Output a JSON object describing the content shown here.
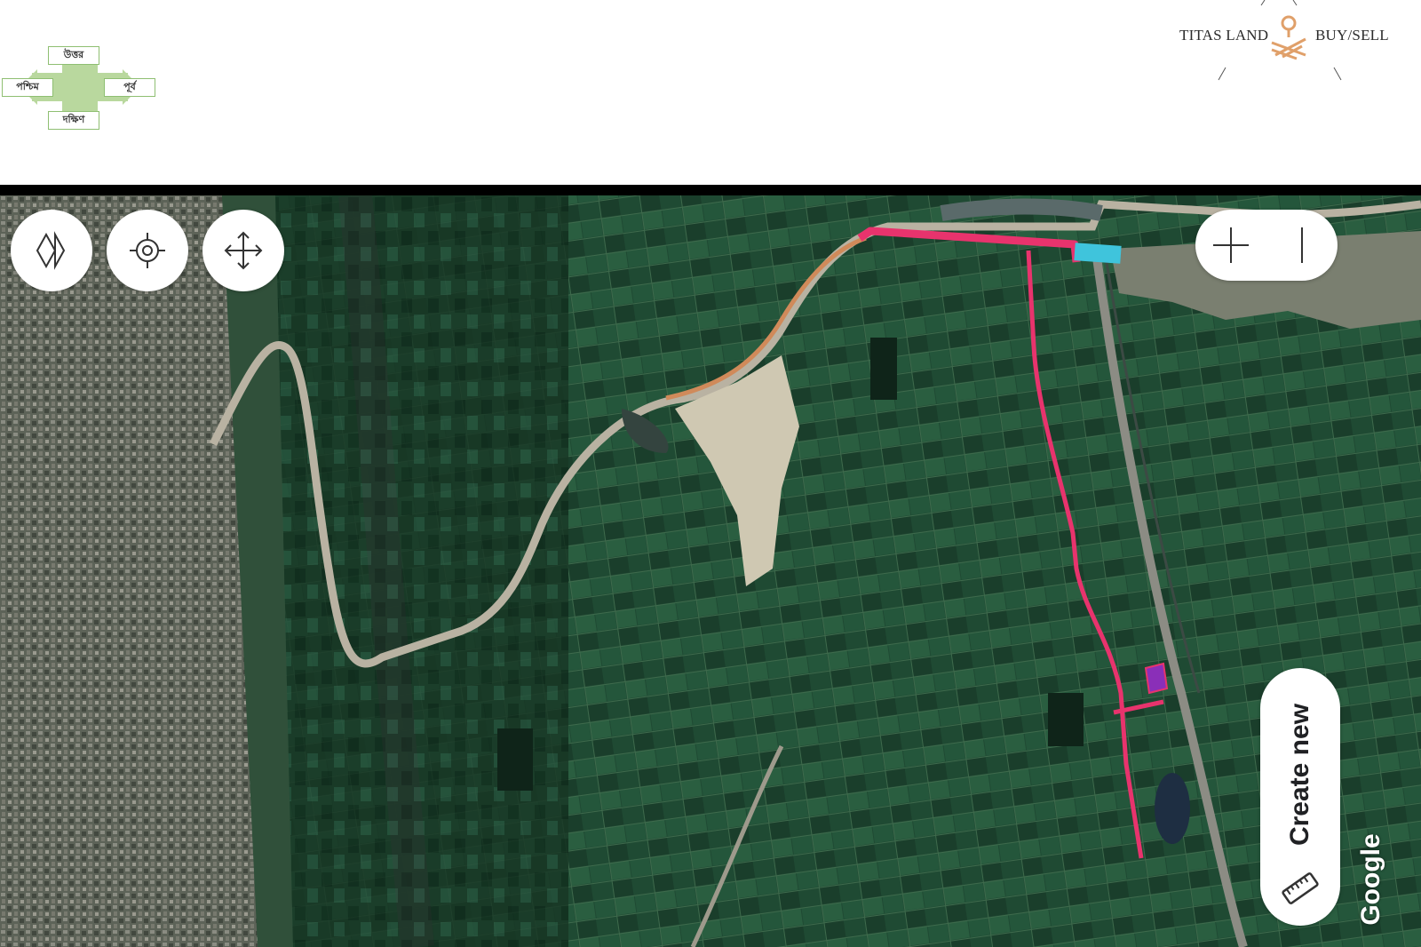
{
  "compass": {
    "north": "উত্তর",
    "south": "দক্ষিণ",
    "west": "পশ্চিম",
    "east": "পূর্ব"
  },
  "brand": {
    "left_text": "TITAS LAND",
    "right_text": "BUY/SELL",
    "mark_color": "#e0a06a",
    "mark_icon": "location-pin-icon"
  },
  "map": {
    "type": "satellite",
    "buttons": {
      "layers": "layers-icon",
      "locate": "crosshair-icon",
      "pan": "move-arrows-icon",
      "zoom_in": "plus-icon",
      "zoom_out": "minus-icon"
    },
    "create_new_label": "Create new",
    "create_new_icon": "ruler-icon",
    "attribution": "Google",
    "overlay_colors": {
      "road_path": "#e8336d",
      "bridge_segment": "#3fc4dc",
      "plot": "#8a2fb8"
    }
  }
}
